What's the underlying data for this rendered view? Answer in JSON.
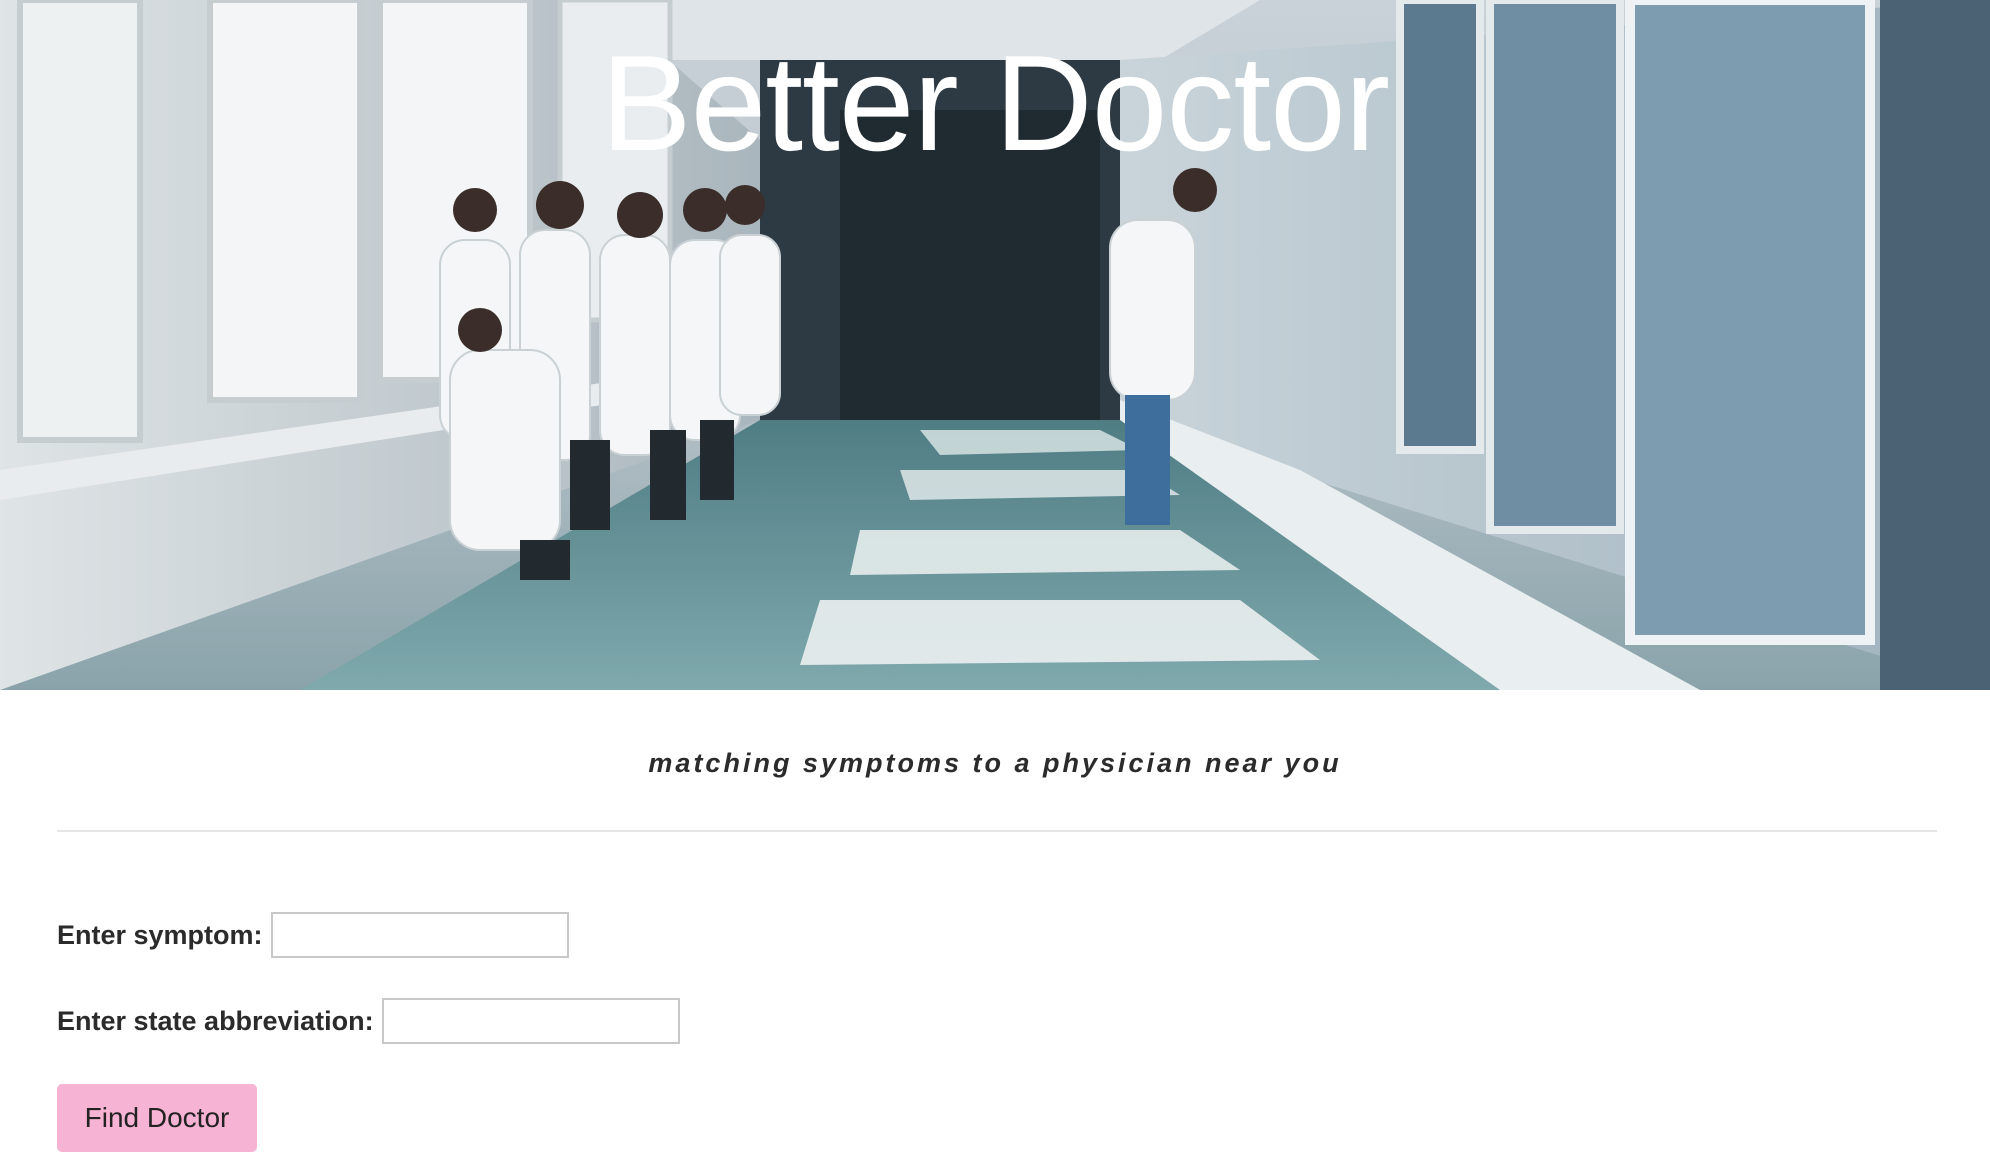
{
  "hero": {
    "title": "Better Doctor",
    "image_alt": "hallway-with-doctors-photo"
  },
  "tagline": "matching symptoms to a physician near you",
  "form": {
    "symptom_label": "Enter symptom:",
    "symptom_value": "",
    "state_label": "Enter state abbreviation:",
    "state_value": "",
    "submit_label": "Find Doctor"
  },
  "colors": {
    "button_bg": "#f7b3d3",
    "title_color": "#ffffff",
    "text_color": "#2b2b2b"
  }
}
